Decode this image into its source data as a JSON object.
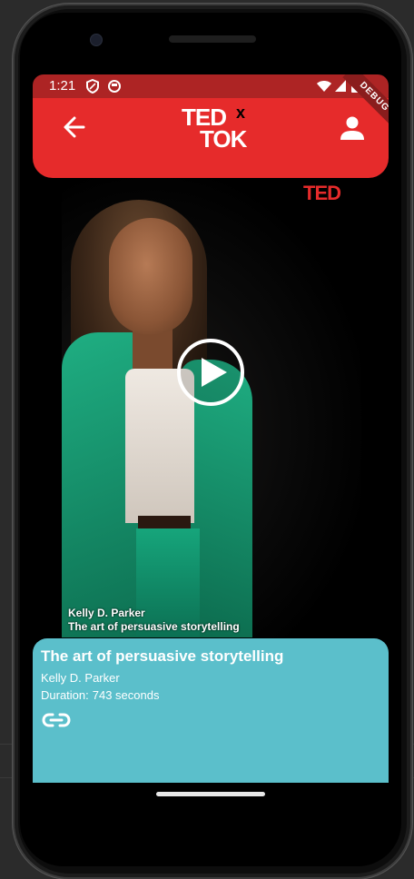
{
  "status_bar": {
    "time": "1:21",
    "icons": [
      "shield-icon",
      "circle-badge-icon",
      "wifi-icon",
      "signal-icon",
      "battery-icon"
    ]
  },
  "app_bar": {
    "back_icon": "arrow-left-icon",
    "logo_line1": "TED",
    "logo_x": "x",
    "logo_line2": "TOK",
    "profile_icon": "person-icon",
    "debug_ribbon": "DEBUG"
  },
  "video": {
    "watermark": "TED",
    "play_icon": "play-circle-icon",
    "speaker": "Kelly D. Parker",
    "title": "The art of persuasive storytelling"
  },
  "details_card": {
    "title": "The art of persuasive storytelling",
    "speaker": "Kelly D. Parker",
    "duration_label": "Duration:",
    "duration_value": "743 seconds",
    "link_icon": "link-icon"
  },
  "colors": {
    "app_bar": "#e62b2b",
    "status_bar": "#ad2424",
    "card": "#5bbfcb",
    "ted_red": "#e62b2b"
  }
}
